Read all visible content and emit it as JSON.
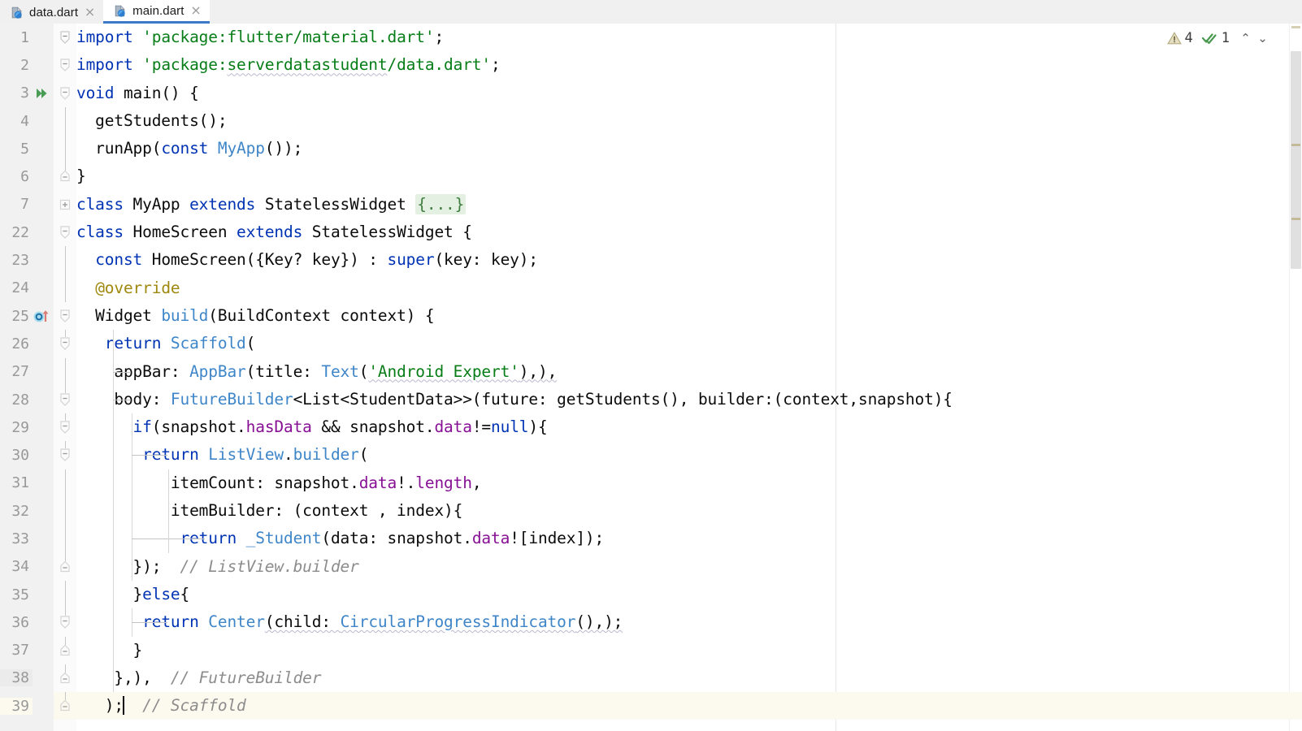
{
  "window": {
    "title": "main.dart"
  },
  "tabs": [
    {
      "label": "data.dart",
      "icon": "dart-file-icon",
      "active": false,
      "close_glyph": "×"
    },
    {
      "label": "main.dart",
      "icon": "dart-file-icon",
      "active": true,
      "close_glyph": "×"
    }
  ],
  "inspections": {
    "warning_icon": "warning-triangle-icon",
    "warning_count": "4",
    "ok_icon": "double-check-icon",
    "ok_count": "1",
    "prev_glyph": "⌃",
    "next_glyph": "⌄"
  },
  "colors": {
    "keyword": "#0033b3",
    "string": "#077d17",
    "type": "#3f86c9",
    "field": "#871094",
    "annotation": "#9e880d",
    "comment": "#8c8c8c",
    "accent_tab": "#3c79c8",
    "current_line": "#fcfaef",
    "fold_placeholder_bg": "#e4f0e2",
    "gutter_bg": "#f1f1f1",
    "editor_bg": "#ffffff",
    "warn_marker": "#c4b998",
    "run_icon": "#499c54"
  },
  "editor": {
    "file": "main.dart",
    "language": "Dart",
    "caret_line": "39",
    "lines": [
      {
        "num": "1",
        "gutter": "",
        "fold": "fold-open"
      },
      {
        "num": "2",
        "gutter": "",
        "fold": "fold-open"
      },
      {
        "num": "3",
        "gutter": "run-gutter-icon",
        "fold": "fold-open"
      },
      {
        "num": "4",
        "gutter": "",
        "fold": ""
      },
      {
        "num": "5",
        "gutter": "",
        "fold": ""
      },
      {
        "num": "6",
        "gutter": "",
        "fold": "fold-end"
      },
      {
        "num": "7",
        "gutter": "",
        "fold": "fold-collapsed"
      },
      {
        "num": "22",
        "gutter": "",
        "fold": "fold-open"
      },
      {
        "num": "23",
        "gutter": "",
        "fold": ""
      },
      {
        "num": "24",
        "gutter": "",
        "fold": ""
      },
      {
        "num": "25",
        "gutter": "override-gutter-icon",
        "fold": "fold-open"
      },
      {
        "num": "26",
        "gutter": "",
        "fold": "fold-open"
      },
      {
        "num": "27",
        "gutter": "",
        "fold": ""
      },
      {
        "num": "28",
        "gutter": "",
        "fold": "fold-open"
      },
      {
        "num": "29",
        "gutter": "",
        "fold": "fold-open"
      },
      {
        "num": "30",
        "gutter": "",
        "fold": "fold-open"
      },
      {
        "num": "31",
        "gutter": "",
        "fold": ""
      },
      {
        "num": "32",
        "gutter": "",
        "fold": ""
      },
      {
        "num": "33",
        "gutter": "",
        "fold": ""
      },
      {
        "num": "34",
        "gutter": "",
        "fold": "fold-end"
      },
      {
        "num": "35",
        "gutter": "",
        "fold": ""
      },
      {
        "num": "36",
        "gutter": "",
        "fold": "fold-open"
      },
      {
        "num": "37",
        "gutter": "",
        "fold": "fold-end"
      },
      {
        "num": "38",
        "gutter": "",
        "fold": "fold-end"
      },
      {
        "num": "39",
        "gutter": "",
        "fold": "fold-end"
      }
    ],
    "code": {
      "l1": "import 'package:flutter/material.dart';",
      "l2": "import 'package:serverdatastudent/data.dart';",
      "l3": "void main() {",
      "l4": "  getStudents();",
      "l5": "  runApp(const MyApp());",
      "l6": "}",
      "l7": "class MyApp extends StatelessWidget {...}",
      "l22": "class HomeScreen extends StatelessWidget {",
      "l23": "  const HomeScreen({Key? key}) : super(key: key);",
      "l24": "  @override",
      "l25": "  Widget build(BuildContext context) {",
      "l26": "   return Scaffold(",
      "l27": "    appBar: AppBar(title: Text('Android Expert'),),",
      "l28": "    body: FutureBuilder<List<StudentData>>(future: getStudents(), builder:(context,snapshot){",
      "l29": "      if(snapshot.hasData && snapshot.data!=null){",
      "l30": "       return ListView.builder(",
      "l31": "          itemCount: snapshot.data!.length,",
      "l32": "          itemBuilder: (context , index){",
      "l33": "           return _Student(data: snapshot.data![index]);",
      "l34": "      });  // ListView.builder",
      "l35": "      }else{",
      "l36": "       return Center(child: CircularProgressIndicator(),);",
      "l37": "      }",
      "l38": "    },),  // FutureBuilder",
      "l39": "   );  // Scaffold"
    },
    "comments": {
      "listview_builder": "// ListView.builder",
      "future_builder": "// FutureBuilder",
      "scaffold": "// Scaffold"
    }
  }
}
